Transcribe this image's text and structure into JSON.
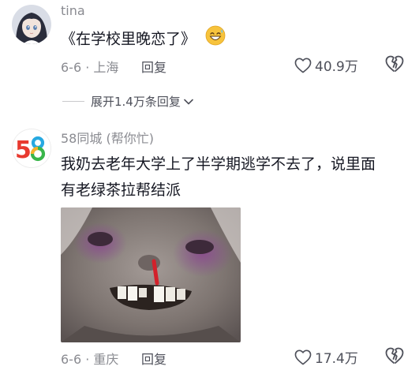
{
  "comments": [
    {
      "username": "tina",
      "text": "《在学校里晚恋了》",
      "emoji_icon": "grinning-sweat-emoji-icon",
      "date": "6-6",
      "location": "上海",
      "reply_label": "回复",
      "like_count": "40.9万"
    },
    {
      "username": "58同城 (帮你忙)",
      "text_line1": "我奶去老年大学上了半学期逃学不去了，说里面",
      "text_line2": "有老绿茶拉帮结派",
      "avatar_logo": "58",
      "date": "6-6",
      "location": "重庆",
      "reply_label": "回复",
      "like_count": "17.4万"
    }
  ],
  "expand_replies": {
    "label": "展开1.4万条回复"
  },
  "colors": {
    "logo_5": "#e8392f",
    "logo_8": "#27a9e1",
    "logo_8_alt": "#f7b12d",
    "logo_8_green": "#39b54a"
  }
}
